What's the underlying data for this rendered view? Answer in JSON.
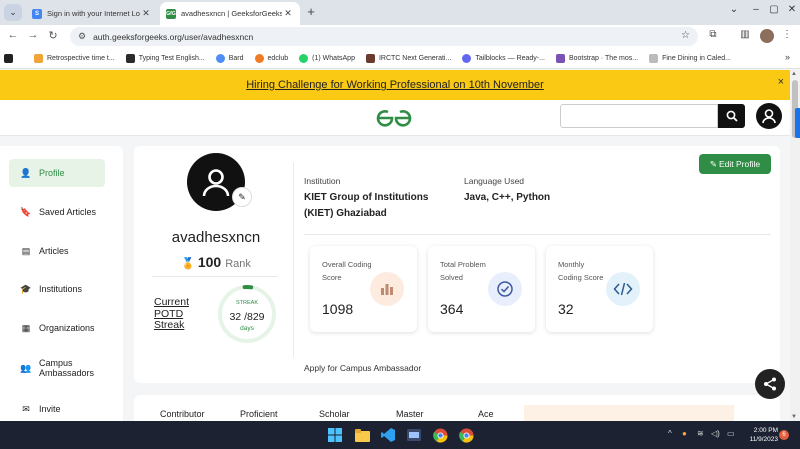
{
  "browser": {
    "tabs": [
      {
        "title": "Sign in with your Internet Login",
        "favicon": "S"
      },
      {
        "title": "avadhesxncn | GeeksforGeeks P",
        "favicon": "GfG"
      }
    ],
    "url": "auth.geeksforgeeks.org/user/avadhesxncn",
    "bookmarks": [
      {
        "label": "Retrospective time t...",
        "color": "#f2a33a"
      },
      {
        "label": "Typing Test English...",
        "color": "#2b2b2b"
      },
      {
        "label": "Bard",
        "color": "#4f8ef7"
      },
      {
        "label": "edclub",
        "color": "#f07b22"
      },
      {
        "label": "(1) WhatsApp",
        "color": "#25d366"
      },
      {
        "label": "IRCTC Next Generati...",
        "color": "#6b3a2e"
      },
      {
        "label": "Tailblocks — Ready-...",
        "color": "#6366f1"
      },
      {
        "label": "Bootstrap · The mos...",
        "color": "#7952b3"
      },
      {
        "label": "Fine Dining in Caled...",
        "color": "#bbbbbb"
      }
    ]
  },
  "banner": {
    "text": "Hiring Challenge for Working Professional on 10th November",
    "close": "×"
  },
  "sidebar": {
    "items": [
      {
        "label": "Profile",
        "icon": "person-icon"
      },
      {
        "label": "Saved Articles",
        "icon": "bookmark-icon"
      },
      {
        "label": "Articles",
        "icon": "document-icon"
      },
      {
        "label": "Institutions",
        "icon": "graduation-cap-icon"
      },
      {
        "label": "Organizations",
        "icon": "building-icon"
      },
      {
        "label": "Campus Ambassadors",
        "icon": "group-icon"
      },
      {
        "label": "Invite",
        "icon": "mail-icon"
      }
    ]
  },
  "profile": {
    "username": "avadhesxncn",
    "rank_value": "100",
    "rank_label": "Rank",
    "potd_label": "Current POTD Streak",
    "streak_label": "STREAK",
    "streak_value": "32 /829",
    "streak_unit": "days",
    "streak_fraction": 0.039,
    "institution_label": "Institution",
    "institution": "KIET Group of Institutions (KIET) Ghaziabad",
    "language_label": "Language Used",
    "languages": "Java, C++, Python",
    "edit_label": "Edit Profile",
    "stats": [
      {
        "label": "Overall Coding Score",
        "value": "1098",
        "icon": "bar-chart-icon",
        "color": "#fdebe0"
      },
      {
        "label": "Total Problem Solved",
        "value": "364",
        "icon": "check-circle-icon",
        "color": "#e8eefb"
      },
      {
        "label": "Monthly Coding Score",
        "value": "32",
        "icon": "code-icon",
        "color": "#e3f1fb"
      }
    ],
    "ambassador": "Apply for Campus Ambassador",
    "badges": [
      "Contributor",
      "Proficient",
      "Scholar",
      "Master",
      "Ace"
    ]
  },
  "taskbar": {
    "time": "2:00 PM",
    "date": "11/9/2023",
    "notifications": "6"
  },
  "colors": {
    "brand": "#2f8d46",
    "banner": "#f9c914"
  }
}
